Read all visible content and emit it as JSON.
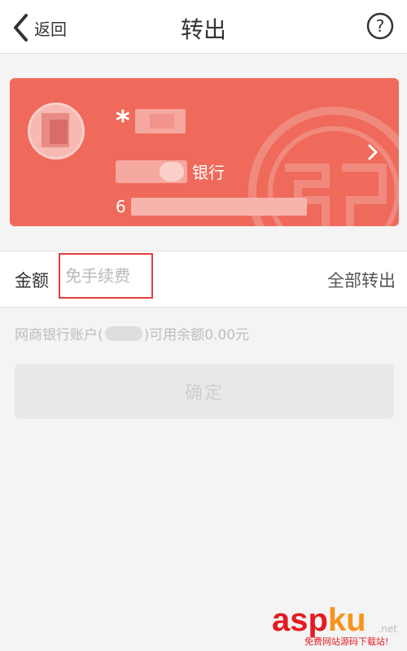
{
  "header": {
    "back_label": "返回",
    "title": "转出",
    "help_symbol": "?"
  },
  "card": {
    "name_prefix": "*",
    "bank_name_suffix": "银行",
    "account_first_digit": "6",
    "background_color": "#ef6a5a"
  },
  "amount": {
    "label": "金额",
    "placeholder": "免手续费",
    "transfer_all": "全部转出"
  },
  "balance": {
    "prefix": "网商银行账户(",
    "suffix": ")可用余额0.00元"
  },
  "confirm": {
    "label": "确定"
  },
  "watermark": {
    "asp": "asp",
    "ku": "ku",
    "net": ".net",
    "sub": "免费网站源码下载站!"
  }
}
